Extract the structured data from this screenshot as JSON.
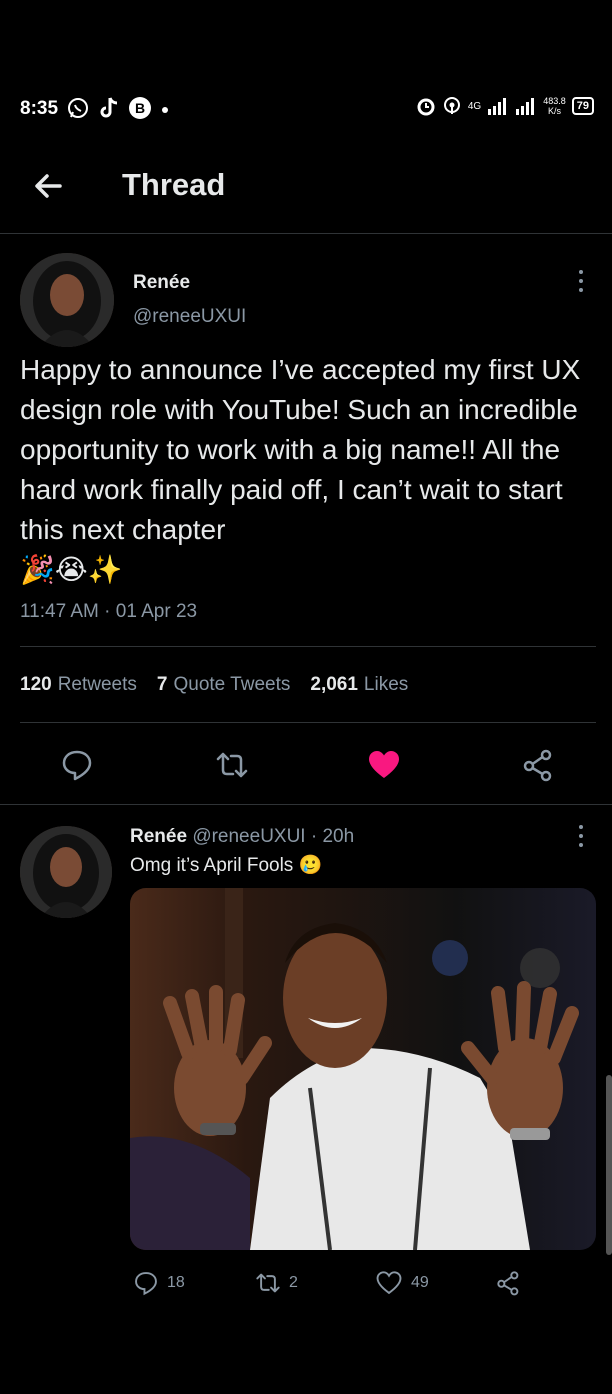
{
  "status_bar": {
    "time": "8:35",
    "network": "4G",
    "speed_value": "483.8",
    "speed_unit": "K/s",
    "battery": "79",
    "left_icons": [
      "whatsapp-icon",
      "tiktok-icon",
      "b-app-icon",
      "dot-icon"
    ],
    "right_icons": [
      "alarm-icon",
      "hotspot-icon",
      "signal-icon",
      "signal-icon"
    ]
  },
  "header": {
    "title": "Thread"
  },
  "tweet": {
    "author_name": "Renée",
    "author_handle": "@reneeUXUI",
    "text": "Happy to announce I’ve accepted my first UX design role with YouTube! Such an incredible opportunity to work with a big name!! All the hard work finally paid off, I can’t wait to start this next chapter",
    "emojis": "🎉😭✨",
    "timestamp": "11:47 AM · 01 Apr 23",
    "stats": [
      {
        "value": "120",
        "label": "Retweets"
      },
      {
        "value": "7",
        "label": "Quote Tweets"
      },
      {
        "value": "2,061",
        "label": "Likes"
      }
    ],
    "liked": true,
    "actions": [
      "reply-icon",
      "retweet-icon",
      "like-icon",
      "share-icon"
    ]
  },
  "reply": {
    "author_name": "Renée",
    "author_handle": "@reneeUXUI",
    "time": "· 20h",
    "text": "Omg it’s April Fools",
    "emoji": "🥲",
    "counts": {
      "replies": "18",
      "retweets": "2",
      "likes": "49"
    }
  },
  "colors": {
    "background": "#000000",
    "text": "#e7e9ea",
    "muted": "#8b98a5",
    "like_active": "#f91880",
    "divider": "#2f3336"
  }
}
